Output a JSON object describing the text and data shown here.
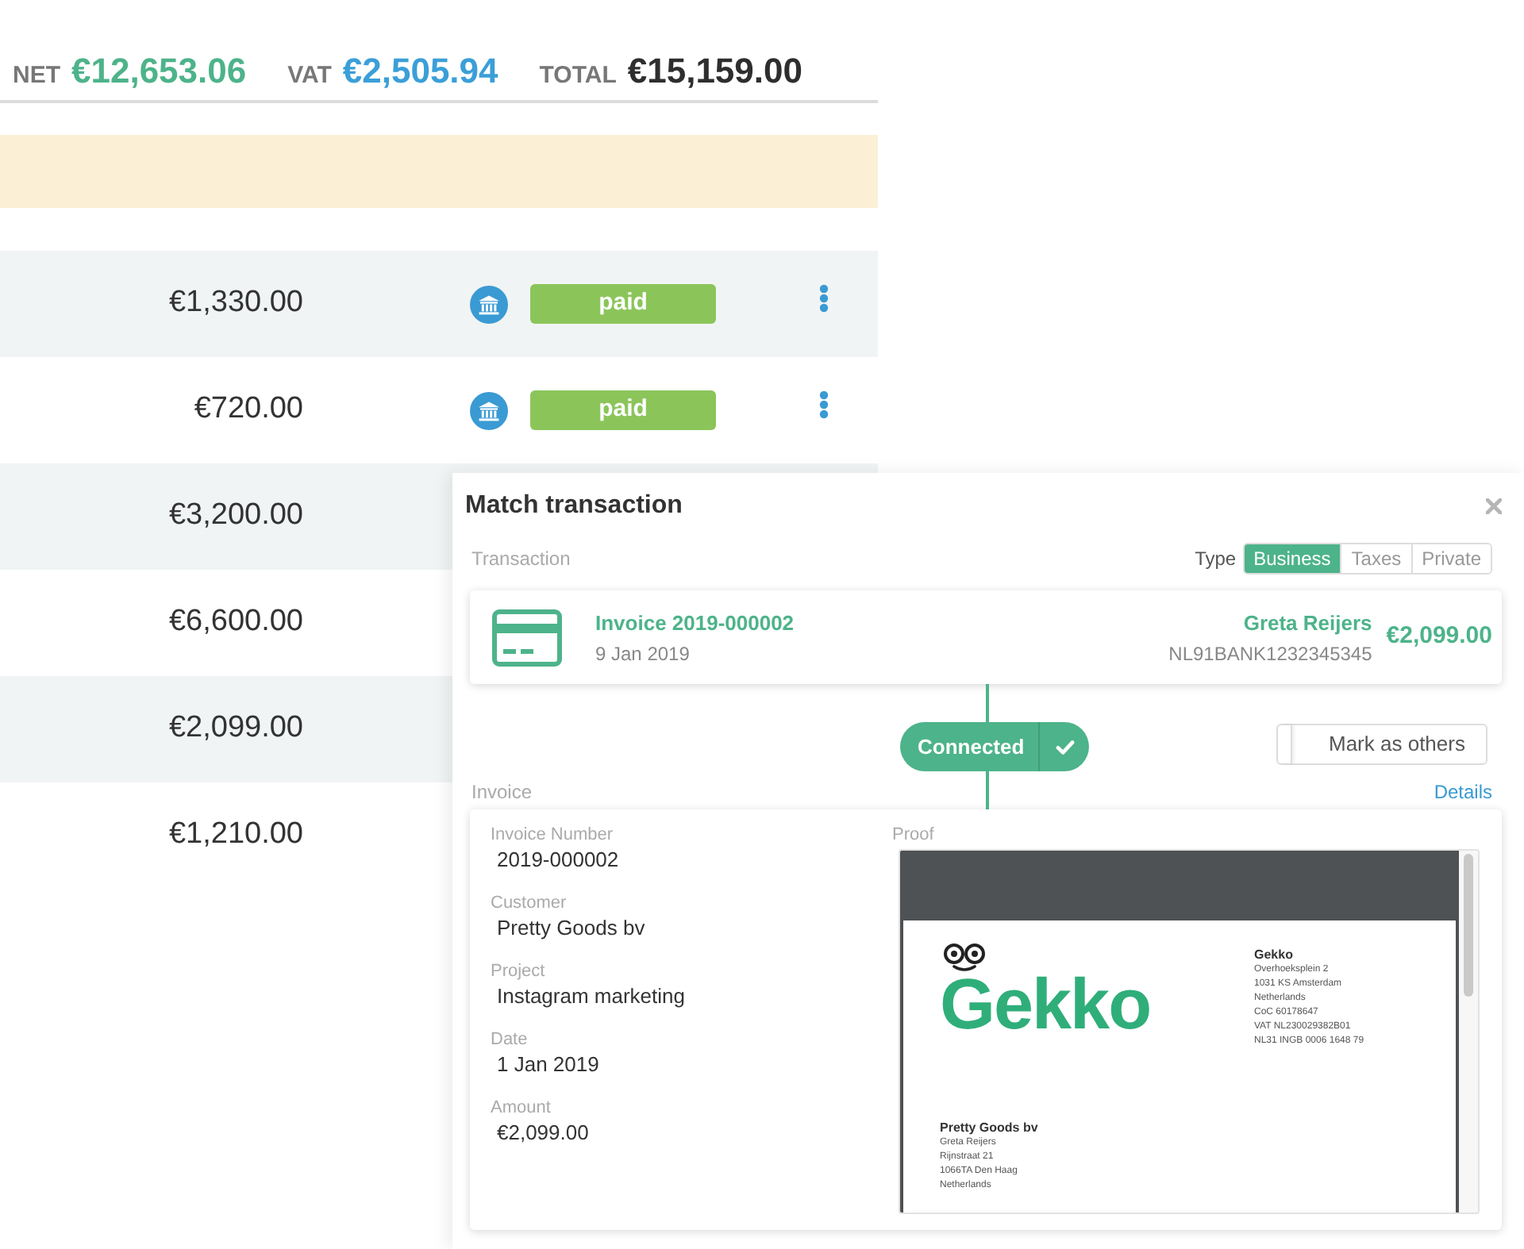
{
  "totals": [
    {
      "label": "NET",
      "amount": "€12,653.06",
      "color": "#4db38a"
    },
    {
      "label": "VAT",
      "amount": "€2,505.94",
      "color": "#3b9fd8"
    },
    {
      "label": "TOTAL",
      "amount": "€15,159.00",
      "color": "#2e2e2e"
    }
  ],
  "rows": [
    {
      "amount": "€1,330.00",
      "status": "paid"
    },
    {
      "amount": "€720.00",
      "status": "paid"
    },
    {
      "amount": "€3,200.00"
    },
    {
      "amount": "€6,600.00"
    },
    {
      "amount": "€2,099.00"
    },
    {
      "amount": "€1,210.00"
    }
  ],
  "match_dialog": {
    "title": "Match transaction",
    "transaction_label": "Transaction",
    "type_label": "Type",
    "type_options": [
      {
        "label": "Business",
        "selected": true
      },
      {
        "label": "Taxes",
        "selected": false
      },
      {
        "label": "Private",
        "selected": false
      }
    ],
    "transaction": {
      "title": "Invoice 2019-000002",
      "date": "9 Jan 2019",
      "name": "Greta Reijers",
      "account": "NL91BANK1232345345",
      "amount": "€2,099.00"
    },
    "connection": {
      "label": "Connected"
    },
    "mark_as_others": {
      "label": "Mark as others",
      "on": false
    },
    "invoice_label": "Invoice",
    "details_link": "Details",
    "invoice_fields": [
      {
        "label": "Invoice Number",
        "value": "2019-000002"
      },
      {
        "label": "Customer",
        "value": "Pretty Goods bv"
      },
      {
        "label": "Project",
        "value": "Instagram marketing"
      },
      {
        "label": "Date",
        "value": "1 Jan 2019"
      },
      {
        "label": "Amount",
        "value": "€2,099.00"
      }
    ],
    "proof": {
      "label": "Proof",
      "document": {
        "logo": "Gekko",
        "sender": {
          "name": "Gekko",
          "lines": [
            "Overhoeksplein 2",
            "1031 KS Amsterdam",
            "Netherlands",
            "CoC 60178647",
            "VAT NL230029382B01",
            "NL31 INGB 0006 1648 79"
          ]
        },
        "recipient": {
          "name": "Pretty Goods bv",
          "lines": [
            "Greta Reijers",
            "Rijnstraat 21",
            "1066TA Den Haag",
            "Netherlands"
          ]
        }
      }
    }
  }
}
